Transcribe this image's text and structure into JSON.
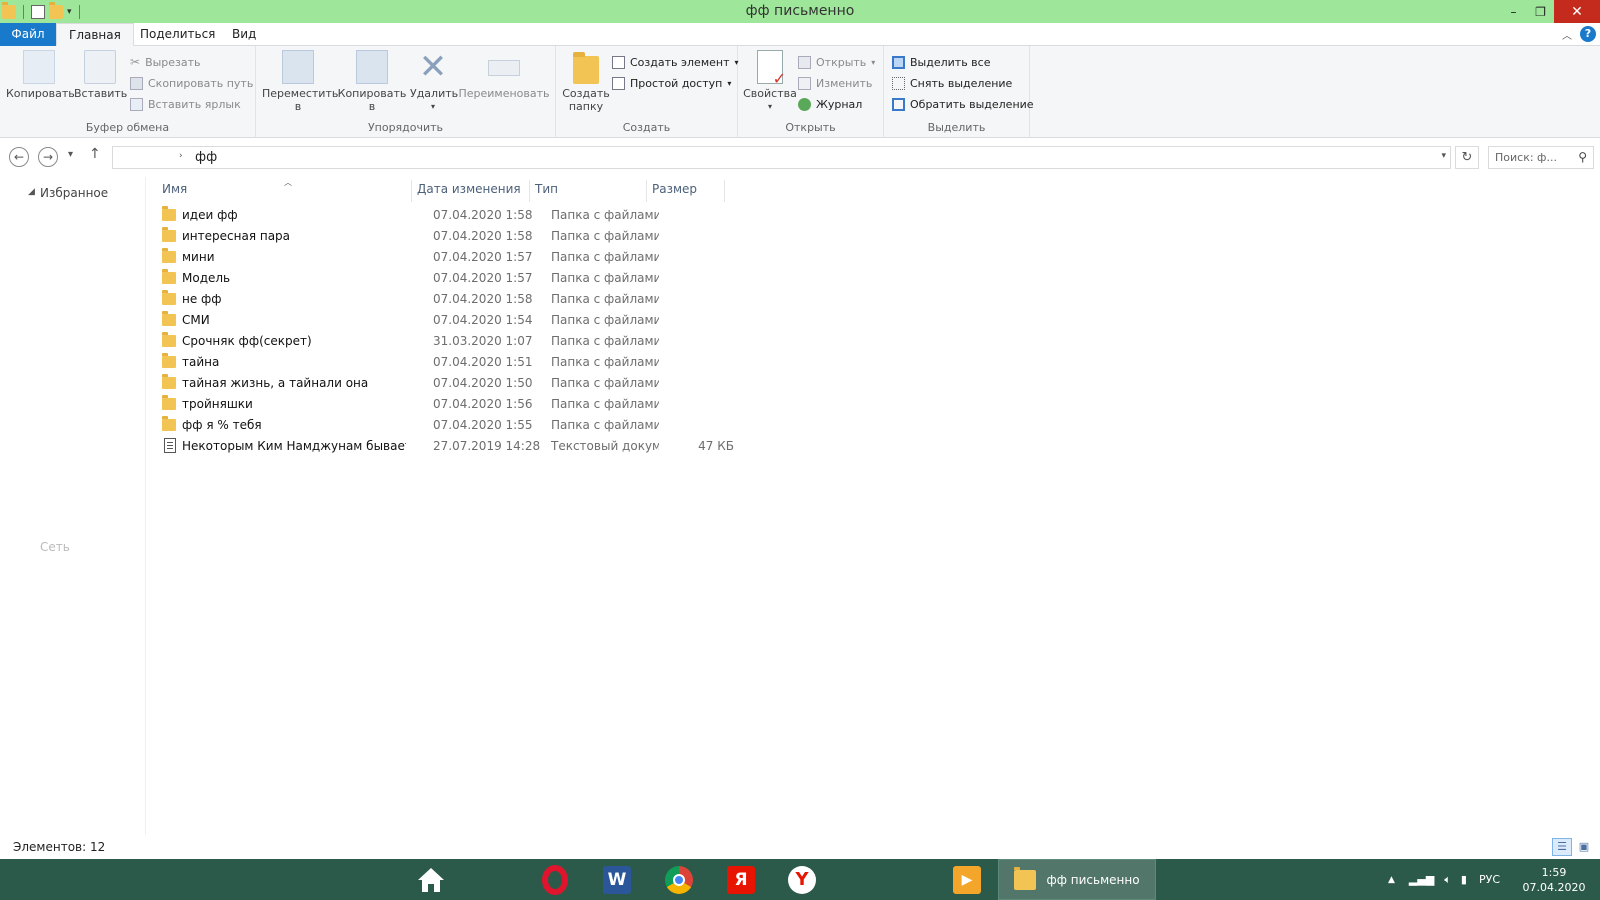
{
  "window": {
    "title": "фф письменно",
    "minimize_label": "–",
    "restore_label": "❐",
    "close_label": "✕"
  },
  "ribbon_tabs": {
    "file": "Файл",
    "home": "Главная",
    "share": "Поделиться",
    "view": "Вид"
  },
  "ribbon": {
    "clipboard": {
      "label": "Буфер обмена",
      "copy": "Копировать",
      "paste": "Вставить",
      "cut": "Вырезать",
      "copy_path": "Скопировать путь",
      "paste_shortcut": "Вставить ярлык"
    },
    "organize": {
      "label": "Упорядочить",
      "move_to_1": "Переместить",
      "move_to_2": "в",
      "copy_to_1": "Копировать",
      "copy_to_2": "в",
      "delete": "Удалить",
      "rename": "Переименовать"
    },
    "create": {
      "label": "Создать",
      "new_folder_1": "Создать",
      "new_folder_2": "папку",
      "new_item": "Создать элемент",
      "easy_access": "Простой доступ"
    },
    "open": {
      "label": "Открыть",
      "properties": "Свойства",
      "open": "Открыть",
      "edit": "Изменить",
      "history": "Журнал"
    },
    "select": {
      "label": "Выделить",
      "select_all": "Выделить все",
      "select_none": "Снять выделение",
      "invert": "Обратить выделение"
    }
  },
  "address": {
    "current": "фф",
    "search_placeholder": "Поиск: ф..."
  },
  "navpane": {
    "favorites": "Избранное",
    "network": "Сеть"
  },
  "columns": {
    "name": "Имя",
    "date": "Дата изменения",
    "type": "Тип",
    "size": "Размер"
  },
  "files": [
    {
      "name": "идеи фф",
      "date": "07.04.2020 1:58",
      "type": "Папка с файлами",
      "size": "",
      "kind": "folder"
    },
    {
      "name": "интересная пара",
      "date": "07.04.2020 1:58",
      "type": "Папка с файлами",
      "size": "",
      "kind": "folder"
    },
    {
      "name": "мини",
      "date": "07.04.2020 1:57",
      "type": "Папка с файлами",
      "size": "",
      "kind": "folder"
    },
    {
      "name": "Модель",
      "date": "07.04.2020 1:57",
      "type": "Папка с файлами",
      "size": "",
      "kind": "folder"
    },
    {
      "name": "не фф",
      "date": "07.04.2020 1:58",
      "type": "Папка с файлами",
      "size": "",
      "kind": "folder"
    },
    {
      "name": "СМИ",
      "date": "07.04.2020 1:54",
      "type": "Папка с файлами",
      "size": "",
      "kind": "folder"
    },
    {
      "name": "Срочняк фф(секрет)",
      "date": "31.03.2020 1:07",
      "type": "Папка с файлами",
      "size": "",
      "kind": "folder"
    },
    {
      "name": "тайна",
      "date": "07.04.2020 1:51",
      "type": "Папка с файлами",
      "size": "",
      "kind": "folder"
    },
    {
      "name": "тайная жизнь, а тайнали она",
      "date": "07.04.2020 1:50",
      "type": "Папка с файлами",
      "size": "",
      "kind": "folder"
    },
    {
      "name": "тройняшки",
      "date": "07.04.2020 1:56",
      "type": "Папка с файлами",
      "size": "",
      "kind": "folder"
    },
    {
      "name": "фф я % тебя",
      "date": "07.04.2020 1:55",
      "type": "Папка с файлами",
      "size": "",
      "kind": "folder"
    },
    {
      "name": "Некоторым Ким Намджунам бывает п...",
      "date": "27.07.2019 14:28",
      "type": "Текстовый докум...",
      "size": "47 КБ",
      "kind": "text"
    }
  ],
  "status": {
    "count": "Элементов: 12"
  },
  "taskbar": {
    "explorer_label": "фф письменно",
    "yandex_letter": "Я",
    "word_letter": "W",
    "lang": "РУС",
    "time": "1:59",
    "date": "07.04.2020"
  },
  "colors": {
    "titlebar": "#9ee79a",
    "file_tab": "#1979ca",
    "taskbar": "#2c5a4a",
    "folder": "#f1c453"
  }
}
